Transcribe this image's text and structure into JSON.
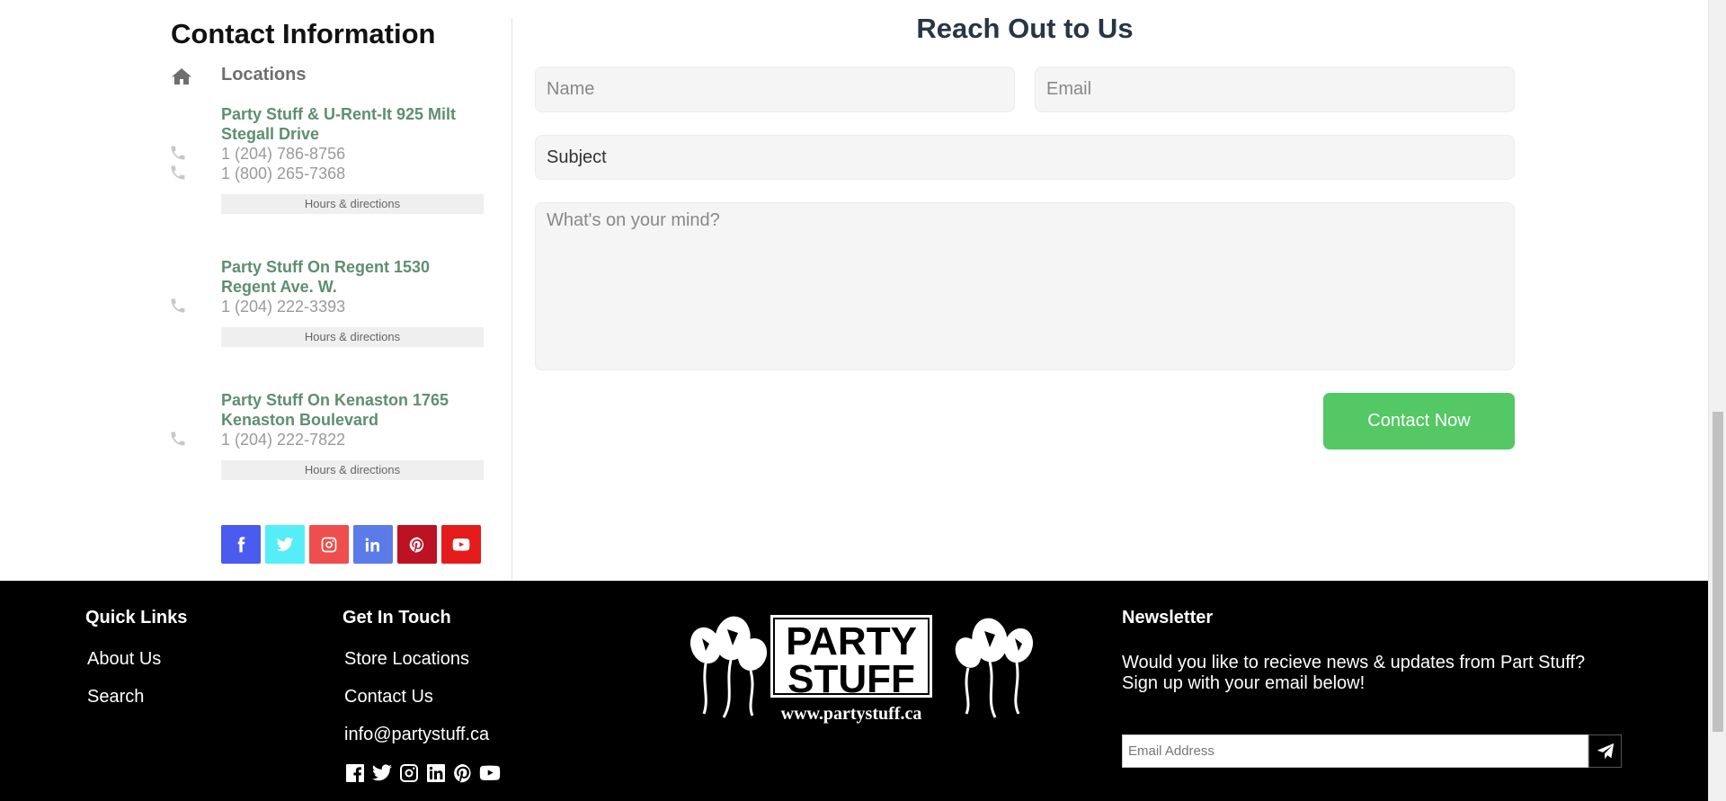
{
  "contact": {
    "title": "Contact Information",
    "locations_label": "Locations",
    "locations": [
      {
        "name": "Party Stuff & U-Rent-It 925 Milt Stegall Drive",
        "phones": [
          "1 (204) 786-8756",
          "1 (800) 265-7368"
        ],
        "hours_label": "Hours & directions"
      },
      {
        "name": "Party Stuff On Regent 1530 Regent Ave. W.",
        "phones": [
          "1 (204) 222-3393"
        ],
        "hours_label": "Hours & directions"
      },
      {
        "name": "Party Stuff On Kenaston 1765 Kenaston Boulevard",
        "phones": [
          "1 (204) 222-7822"
        ],
        "hours_label": "Hours & directions"
      }
    ],
    "social": [
      {
        "icon": "facebook-icon",
        "color": "#4a5bf0"
      },
      {
        "icon": "twitter-icon",
        "color": "#55eef8"
      },
      {
        "icon": "instagram-icon",
        "color": "#ef4e4e"
      },
      {
        "icon": "linkedin-icon",
        "color": "#5b7be8"
      },
      {
        "icon": "pinterest-icon",
        "color": "#bd1224"
      },
      {
        "icon": "youtube-icon",
        "color": "#e51b1b"
      }
    ]
  },
  "form": {
    "title": "Reach Out to Us",
    "name_placeholder": "Name",
    "email_placeholder": "Email",
    "subject_value": "Subject",
    "message_placeholder": "What's on your mind?",
    "submit_label": "Contact Now",
    "submit_color": "#53c865"
  },
  "footer": {
    "quick_links": {
      "title": "Quick Links",
      "items": [
        "About Us",
        "Search"
      ]
    },
    "get_in_touch": {
      "title": "Get In Touch",
      "items": [
        "Store Locations",
        "Contact Us",
        "info@partystuff.ca"
      ]
    },
    "icons": [
      "facebook-square-icon",
      "twitter-icon",
      "instagram-icon",
      "linkedin-icon",
      "pinterest-icon",
      "youtube-icon"
    ],
    "logo": {
      "line1": "PARTY",
      "line2": "STUFF",
      "url": "www.partystuff.ca"
    },
    "newsletter": {
      "title": "Newsletter",
      "text": "Would you like to recieve news & updates from Part Stuff? Sign up with your email below!",
      "placeholder": "Email Address"
    }
  }
}
